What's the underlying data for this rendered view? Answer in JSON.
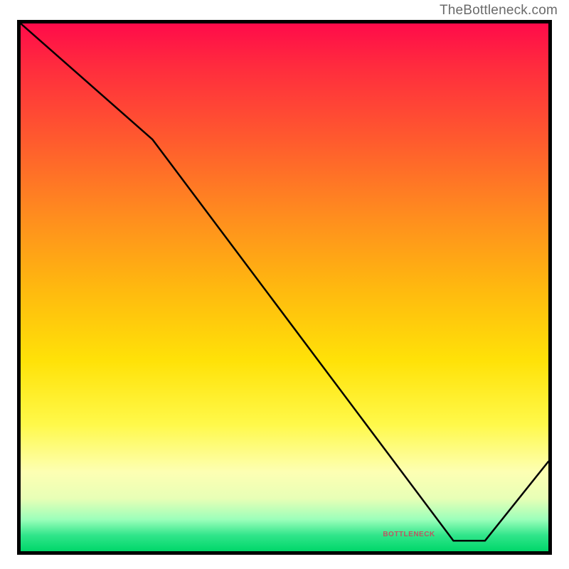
{
  "attribution": "TheBottleneck.com",
  "watermark_text": "BOTTLENECK",
  "chart_data": {
    "type": "line",
    "title": "",
    "xlabel": "",
    "ylabel": "",
    "xlim": [
      0,
      100
    ],
    "ylim": [
      0,
      100
    ],
    "series": [
      {
        "name": "curve",
        "x": [
          0,
          25,
          82,
          88,
          100
        ],
        "y": [
          100,
          78,
          2,
          2,
          17
        ]
      }
    ],
    "background_gradient": {
      "orientation": "vertical",
      "stops": [
        {
          "pos": 0.0,
          "color": "#ff0b4a"
        },
        {
          "pos": 0.5,
          "color": "#ffe208"
        },
        {
          "pos": 0.85,
          "color": "#fdffb3"
        },
        {
          "pos": 1.0,
          "color": "#00d76a"
        }
      ]
    }
  }
}
